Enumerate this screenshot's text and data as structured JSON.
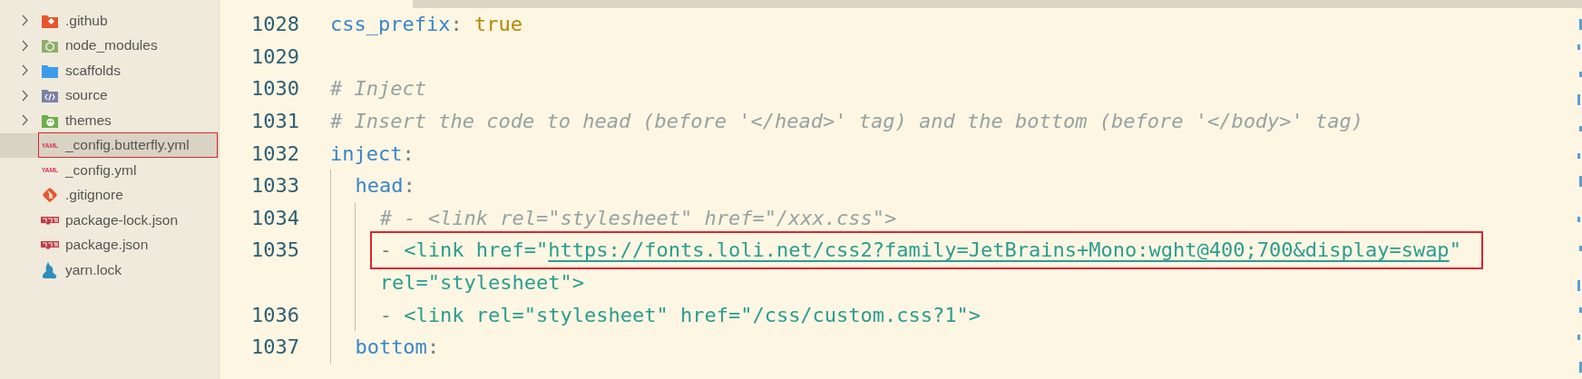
{
  "sidebar": {
    "items": [
      {
        "name": ".github",
        "kind": "gitfolder",
        "expanded": false,
        "selected": false,
        "marked": false
      },
      {
        "name": "node_modules",
        "kind": "nodefolder",
        "expanded": false,
        "selected": false,
        "marked": false
      },
      {
        "name": "scaffolds",
        "kind": "folder",
        "expanded": false,
        "selected": false,
        "marked": false
      },
      {
        "name": "source",
        "kind": "codefolder",
        "expanded": false,
        "selected": false,
        "marked": false
      },
      {
        "name": "themes",
        "kind": "themefolder",
        "expanded": false,
        "selected": false,
        "marked": false
      },
      {
        "name": "_config.butterfly.yml",
        "kind": "yaml",
        "badge": "YAML",
        "selected": true,
        "marked": true
      },
      {
        "name": "_config.yml",
        "kind": "yaml",
        "badge": "YAML",
        "selected": false,
        "marked": false
      },
      {
        "name": ".gitignore",
        "kind": "git",
        "selected": false,
        "marked": false
      },
      {
        "name": "package-lock.json",
        "kind": "npm",
        "selected": false,
        "marked": false
      },
      {
        "name": "package.json",
        "kind": "npm",
        "selected": false,
        "marked": false
      },
      {
        "name": "yarn.lock",
        "kind": "yarn",
        "selected": false,
        "marked": false
      }
    ]
  },
  "editor": {
    "lines": [
      {
        "number": "1028",
        "tokens": [
          {
            "kind": "key",
            "text": "css_prefix"
          },
          {
            "kind": "punct",
            "text": ": "
          },
          {
            "kind": "bool",
            "text": "true"
          }
        ]
      },
      {
        "number": "1029"
      },
      {
        "number": "1030",
        "tokens": [
          {
            "kind": "comment",
            "text": "# Inject"
          }
        ]
      },
      {
        "number": "1031",
        "tokens": [
          {
            "kind": "comment",
            "text": "# Insert the code to head (before '</head>' tag) and the bottom (before '</body>' tag)"
          }
        ]
      },
      {
        "number": "1032",
        "tokens": [
          {
            "kind": "key",
            "text": "inject"
          },
          {
            "kind": "punct",
            "text": ":"
          }
        ],
        "children": [
          {
            "number": "1033",
            "tokens": [
              {
                "kind": "key",
                "text": "head"
              },
              {
                "kind": "punct",
                "text": ":"
              }
            ],
            "children": [
              {
                "number": "1034",
                "tokens": [
                  {
                    "kind": "comment",
                    "text": "# - <link rel=\"stylesheet\" href=\"/xxx.css\">"
                  }
                ]
              },
              {
                "number": "1035",
                "marked": true,
                "tokens": [
                  {
                    "kind": "punct",
                    "text": "- "
                  },
                  {
                    "kind": "string",
                    "text": "<link href=\""
                  },
                  {
                    "kind": "link",
                    "text": "https://fonts.loli.net/css2?family=JetBrains+Mono:wght@400;700&display=swap"
                  },
                  {
                    "kind": "string",
                    "text": "\""
                  }
                ],
                "continuation": [
                  {
                    "kind": "string",
                    "text": "rel=\"stylesheet\">"
                  }
                ]
              },
              {
                "number": "1036",
                "tokens": [
                  {
                    "kind": "punct",
                    "text": "- "
                  },
                  {
                    "kind": "string",
                    "text": "<link rel=\"stylesheet\" href=\"/css/custom.css?1\">"
                  }
                ]
              }
            ]
          },
          {
            "number": "1037",
            "tokens": [
              {
                "kind": "key",
                "text": "bottom"
              },
              {
                "kind": "punct",
                "text": ":"
              }
            ]
          }
        ]
      }
    ]
  }
}
